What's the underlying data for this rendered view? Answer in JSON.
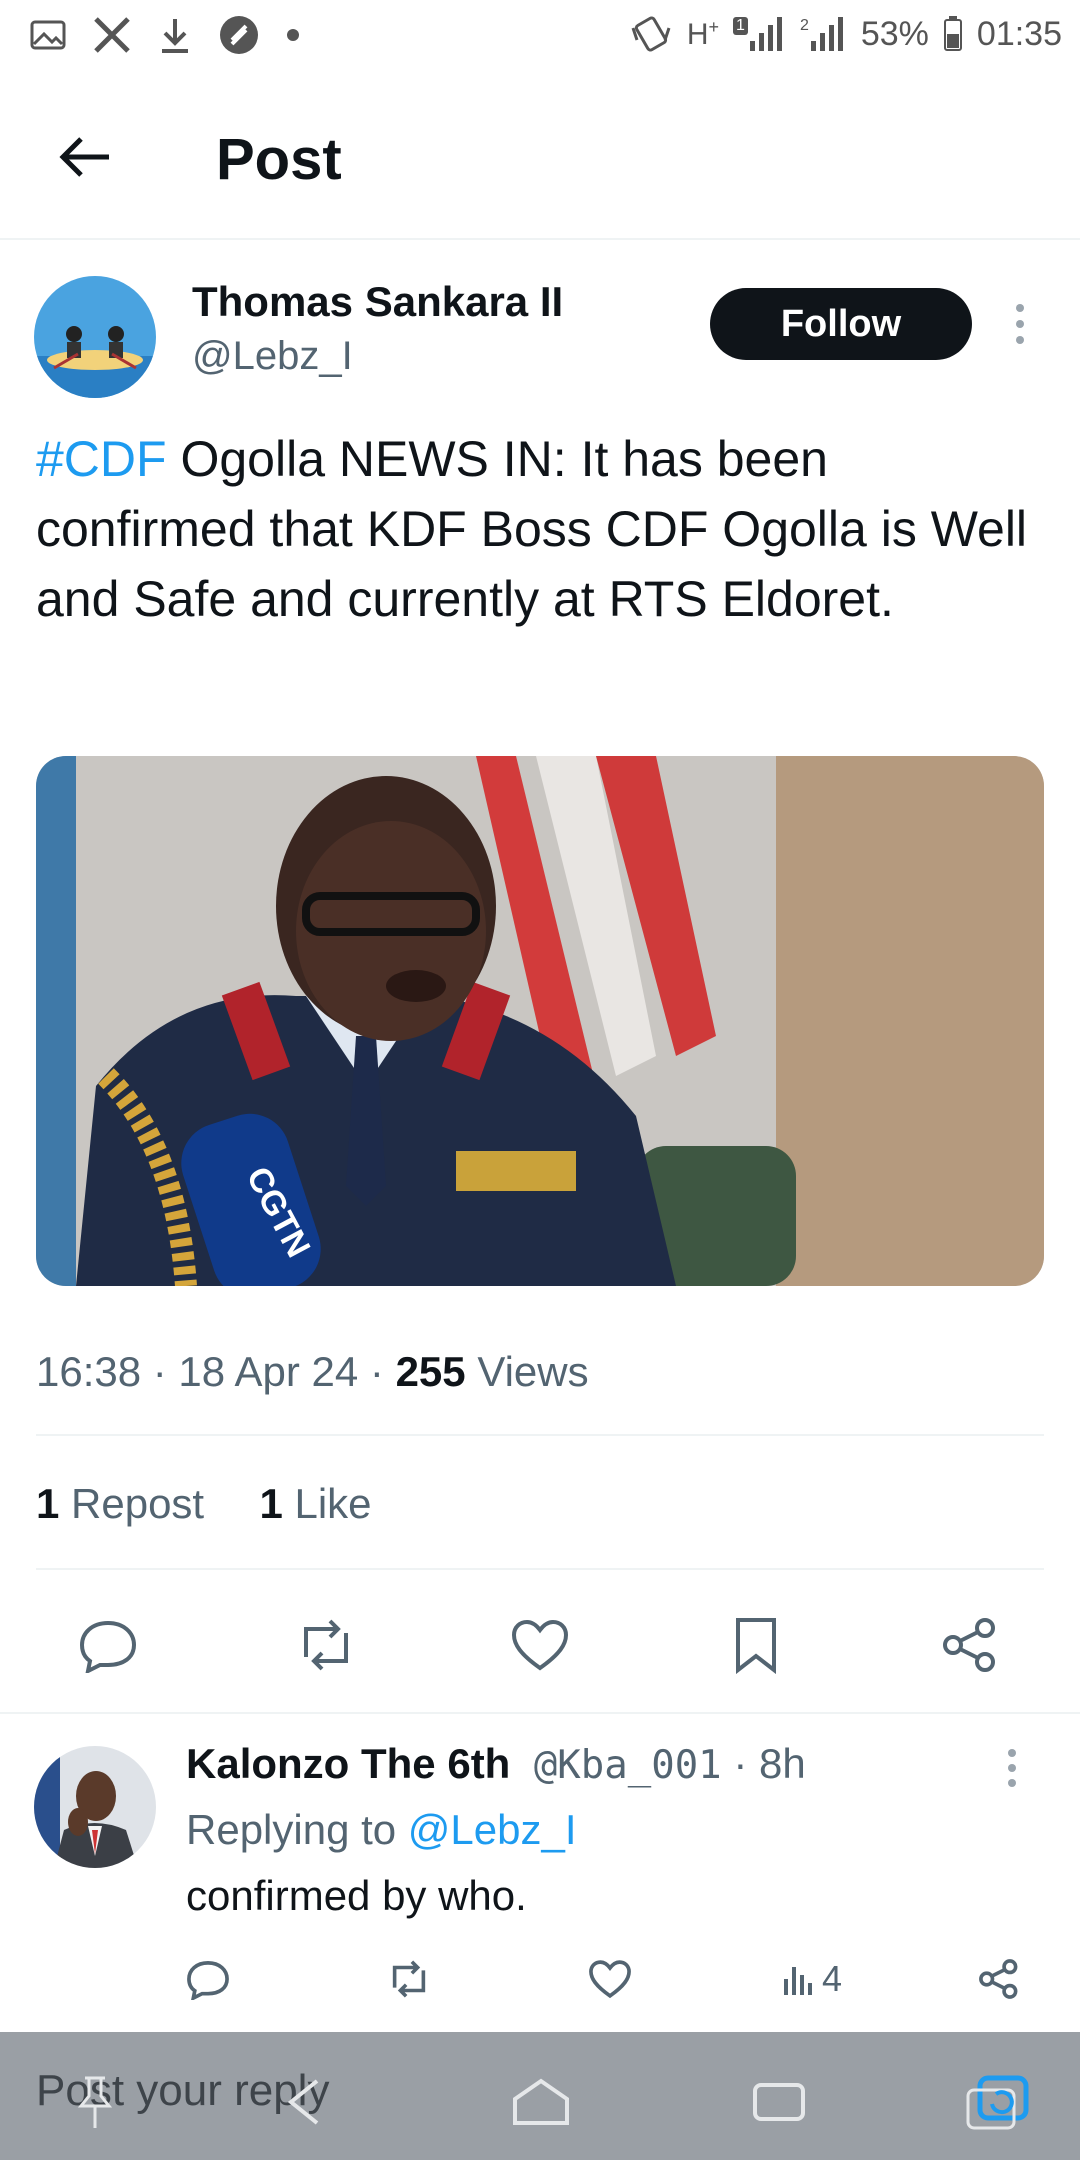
{
  "status_bar": {
    "left_icons": [
      "gallery-icon",
      "x-logo-icon",
      "download-icon",
      "threads-icon",
      "dot-icon"
    ],
    "right_icons": [
      "vibrate-icon",
      "hplus-icon",
      "signal-1-icon",
      "signal-2-icon"
    ],
    "network": "H",
    "network_plus": "+",
    "sim1": "1",
    "sim2": "2",
    "battery": "53%",
    "time": "01:35"
  },
  "header": {
    "title": "Post"
  },
  "tweet": {
    "author_name": "Thomas Sankara II",
    "author_handle": "@Lebz_I",
    "follow_label": "Follow",
    "hashtag": "#CDF",
    "text": " Ogolla NEWS IN: It has been confirmed that KDF Boss CDF Ogolla is Well and Safe and currently at RTS Eldoret.",
    "media_badge": "CGTN",
    "timestamp": "16:38 · 18 Apr 24 · ",
    "views_count": "255",
    "views_label": " Views",
    "reposts_count": "1",
    "reposts_label": " Repost",
    "likes_count": "1",
    "likes_label": " Like",
    "actions": [
      "reply-icon",
      "repost-icon",
      "like-icon",
      "bookmark-icon",
      "share-icon"
    ]
  },
  "reply": {
    "name": "Kalonzo The 6th",
    "handle": " @Kba_001",
    "time": " · 8h",
    "replying_prefix": "Replying to ",
    "replying_to": "@Lebz_I",
    "text": "confirmed by who.",
    "views": "4"
  },
  "composer": {
    "placeholder": "Post your reply"
  },
  "colors": {
    "accent": "#1d9bf0",
    "text": "#0f1419",
    "muted": "#536471",
    "follow_bg": "#0f1419"
  }
}
